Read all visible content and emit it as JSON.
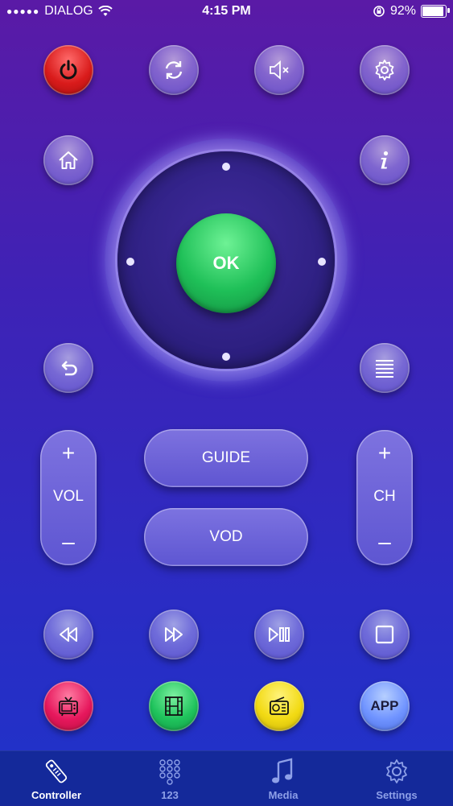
{
  "status_bar": {
    "carrier_dots": "●●●●●",
    "carrier": "DIALOG",
    "time": "4:15 PM",
    "battery": "92%",
    "battery_level": 0.92
  },
  "remote": {
    "top_row": [
      {
        "id": "power",
        "icon": "power-icon",
        "color": "#d91b1b"
      },
      {
        "id": "refresh",
        "icon": "refresh-icon"
      },
      {
        "id": "mute",
        "icon": "mute-icon"
      },
      {
        "id": "settings",
        "icon": "gear-icon"
      }
    ],
    "home_icon": "home-icon",
    "info_icon": "info-icon",
    "back_icon": "back-icon",
    "menu_icon": "menu-icon",
    "ok_label": "OK",
    "vol": {
      "plus": "+",
      "label": "VOL",
      "minus": "–"
    },
    "ch": {
      "plus": "+",
      "label": "CH",
      "minus": "–"
    },
    "guide_label": "GUIDE",
    "vod_label": "VOD",
    "media_row": [
      "rewind-icon",
      "fast-forward-icon",
      "play-pause-icon",
      "stop-icon"
    ],
    "source_row": [
      {
        "id": "tv",
        "icon": "tv-icon",
        "color": "#e6175c"
      },
      {
        "id": "film",
        "icon": "film-icon",
        "color": "#1fc35c"
      },
      {
        "id": "radio",
        "icon": "radio-icon",
        "color": "#f2da13"
      },
      {
        "id": "app",
        "label": "APP",
        "color": "#6f93ff"
      }
    ]
  },
  "tabbar": {
    "tabs": [
      {
        "label": "Controller",
        "icon": "remote-icon",
        "active": true
      },
      {
        "label": "123",
        "icon": "keypad-icon",
        "active": false
      },
      {
        "label": "Media",
        "icon": "music-note-icon",
        "active": false
      },
      {
        "label": "Settings",
        "icon": "gear-icon",
        "active": false
      }
    ]
  }
}
